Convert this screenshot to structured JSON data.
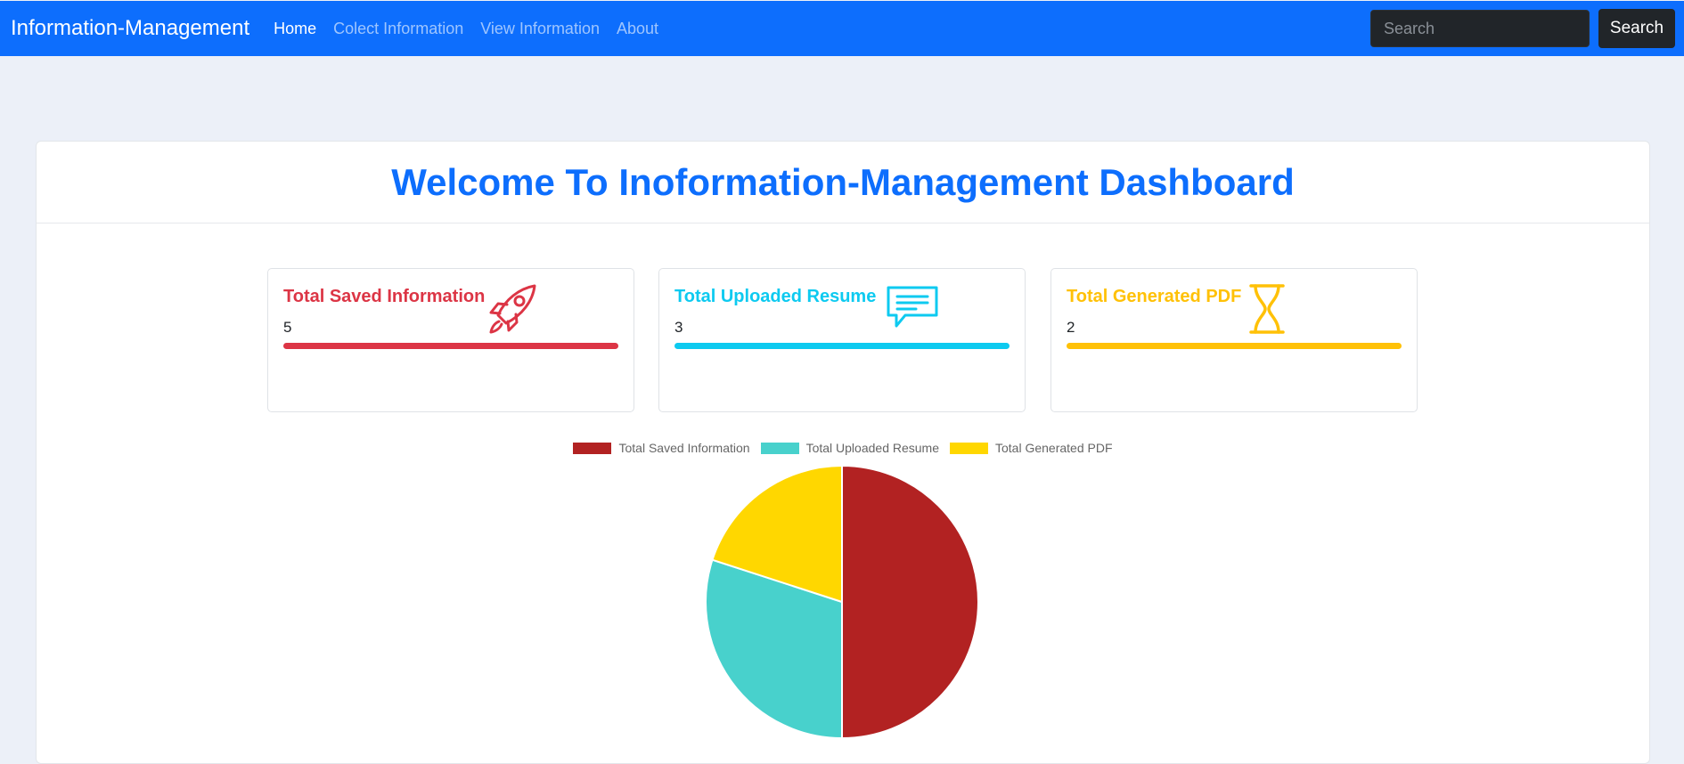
{
  "navbar": {
    "brand": "Information-Management",
    "links": [
      {
        "label": "Home"
      },
      {
        "label": "Colect Information"
      },
      {
        "label": "View Information"
      },
      {
        "label": "About"
      }
    ],
    "search": {
      "placeholder": "Search",
      "button_label": "Search"
    }
  },
  "dashboard": {
    "title": "Welcome To Inoformation-Management Dashboard",
    "cards": [
      {
        "title": "Total Saved Information",
        "value": "5",
        "color": "#dc3545",
        "icon": "rocket-icon"
      },
      {
        "title": "Total Uploaded Resume",
        "value": "3",
        "color": "#0dcaf0",
        "icon": "chat-icon"
      },
      {
        "title": "Total Generated PDF",
        "value": "2",
        "color": "#ffc107",
        "icon": "hourglass-icon"
      }
    ]
  },
  "chart_data": {
    "type": "pie",
    "categories": [
      "Total Saved Information",
      "Total Uploaded Resume",
      "Total Generated PDF"
    ],
    "values": [
      5,
      3,
      2
    ],
    "colors": [
      "#b22222",
      "#48d1cc",
      "#ffd700"
    ],
    "legend": "top"
  }
}
